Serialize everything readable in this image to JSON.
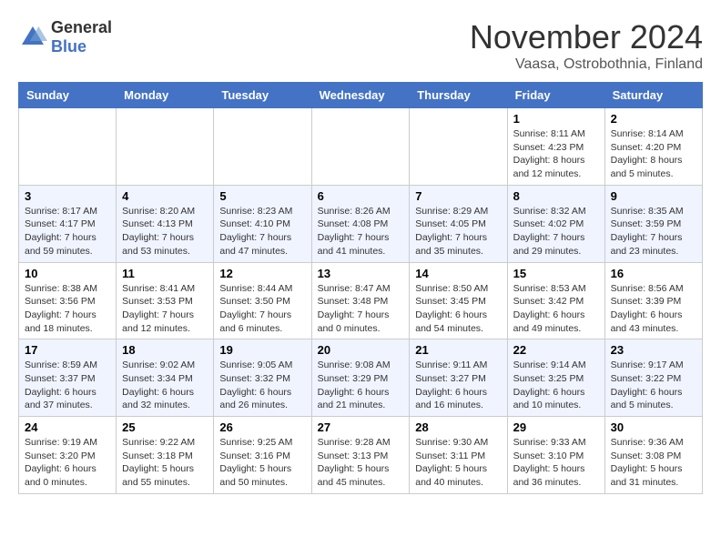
{
  "logo": {
    "text_general": "General",
    "text_blue": "Blue"
  },
  "title": "November 2024",
  "location": "Vaasa, Ostrobothnia, Finland",
  "days_of_week": [
    "Sunday",
    "Monday",
    "Tuesday",
    "Wednesday",
    "Thursday",
    "Friday",
    "Saturday"
  ],
  "weeks": [
    [
      {
        "day": "",
        "info": ""
      },
      {
        "day": "",
        "info": ""
      },
      {
        "day": "",
        "info": ""
      },
      {
        "day": "",
        "info": ""
      },
      {
        "day": "",
        "info": ""
      },
      {
        "day": "1",
        "info": "Sunrise: 8:11 AM\nSunset: 4:23 PM\nDaylight: 8 hours and 12 minutes."
      },
      {
        "day": "2",
        "info": "Sunrise: 8:14 AM\nSunset: 4:20 PM\nDaylight: 8 hours and 5 minutes."
      }
    ],
    [
      {
        "day": "3",
        "info": "Sunrise: 8:17 AM\nSunset: 4:17 PM\nDaylight: 7 hours and 59 minutes."
      },
      {
        "day": "4",
        "info": "Sunrise: 8:20 AM\nSunset: 4:13 PM\nDaylight: 7 hours and 53 minutes."
      },
      {
        "day": "5",
        "info": "Sunrise: 8:23 AM\nSunset: 4:10 PM\nDaylight: 7 hours and 47 minutes."
      },
      {
        "day": "6",
        "info": "Sunrise: 8:26 AM\nSunset: 4:08 PM\nDaylight: 7 hours and 41 minutes."
      },
      {
        "day": "7",
        "info": "Sunrise: 8:29 AM\nSunset: 4:05 PM\nDaylight: 7 hours and 35 minutes."
      },
      {
        "day": "8",
        "info": "Sunrise: 8:32 AM\nSunset: 4:02 PM\nDaylight: 7 hours and 29 minutes."
      },
      {
        "day": "9",
        "info": "Sunrise: 8:35 AM\nSunset: 3:59 PM\nDaylight: 7 hours and 23 minutes."
      }
    ],
    [
      {
        "day": "10",
        "info": "Sunrise: 8:38 AM\nSunset: 3:56 PM\nDaylight: 7 hours and 18 minutes."
      },
      {
        "day": "11",
        "info": "Sunrise: 8:41 AM\nSunset: 3:53 PM\nDaylight: 7 hours and 12 minutes."
      },
      {
        "day": "12",
        "info": "Sunrise: 8:44 AM\nSunset: 3:50 PM\nDaylight: 7 hours and 6 minutes."
      },
      {
        "day": "13",
        "info": "Sunrise: 8:47 AM\nSunset: 3:48 PM\nDaylight: 7 hours and 0 minutes."
      },
      {
        "day": "14",
        "info": "Sunrise: 8:50 AM\nSunset: 3:45 PM\nDaylight: 6 hours and 54 minutes."
      },
      {
        "day": "15",
        "info": "Sunrise: 8:53 AM\nSunset: 3:42 PM\nDaylight: 6 hours and 49 minutes."
      },
      {
        "day": "16",
        "info": "Sunrise: 8:56 AM\nSunset: 3:39 PM\nDaylight: 6 hours and 43 minutes."
      }
    ],
    [
      {
        "day": "17",
        "info": "Sunrise: 8:59 AM\nSunset: 3:37 PM\nDaylight: 6 hours and 37 minutes."
      },
      {
        "day": "18",
        "info": "Sunrise: 9:02 AM\nSunset: 3:34 PM\nDaylight: 6 hours and 32 minutes."
      },
      {
        "day": "19",
        "info": "Sunrise: 9:05 AM\nSunset: 3:32 PM\nDaylight: 6 hours and 26 minutes."
      },
      {
        "day": "20",
        "info": "Sunrise: 9:08 AM\nSunset: 3:29 PM\nDaylight: 6 hours and 21 minutes."
      },
      {
        "day": "21",
        "info": "Sunrise: 9:11 AM\nSunset: 3:27 PM\nDaylight: 6 hours and 16 minutes."
      },
      {
        "day": "22",
        "info": "Sunrise: 9:14 AM\nSunset: 3:25 PM\nDaylight: 6 hours and 10 minutes."
      },
      {
        "day": "23",
        "info": "Sunrise: 9:17 AM\nSunset: 3:22 PM\nDaylight: 6 hours and 5 minutes."
      }
    ],
    [
      {
        "day": "24",
        "info": "Sunrise: 9:19 AM\nSunset: 3:20 PM\nDaylight: 6 hours and 0 minutes."
      },
      {
        "day": "25",
        "info": "Sunrise: 9:22 AM\nSunset: 3:18 PM\nDaylight: 5 hours and 55 minutes."
      },
      {
        "day": "26",
        "info": "Sunrise: 9:25 AM\nSunset: 3:16 PM\nDaylight: 5 hours and 50 minutes."
      },
      {
        "day": "27",
        "info": "Sunrise: 9:28 AM\nSunset: 3:13 PM\nDaylight: 5 hours and 45 minutes."
      },
      {
        "day": "28",
        "info": "Sunrise: 9:30 AM\nSunset: 3:11 PM\nDaylight: 5 hours and 40 minutes."
      },
      {
        "day": "29",
        "info": "Sunrise: 9:33 AM\nSunset: 3:10 PM\nDaylight: 5 hours and 36 minutes."
      },
      {
        "day": "30",
        "info": "Sunrise: 9:36 AM\nSunset: 3:08 PM\nDaylight: 5 hours and 31 minutes."
      }
    ]
  ]
}
